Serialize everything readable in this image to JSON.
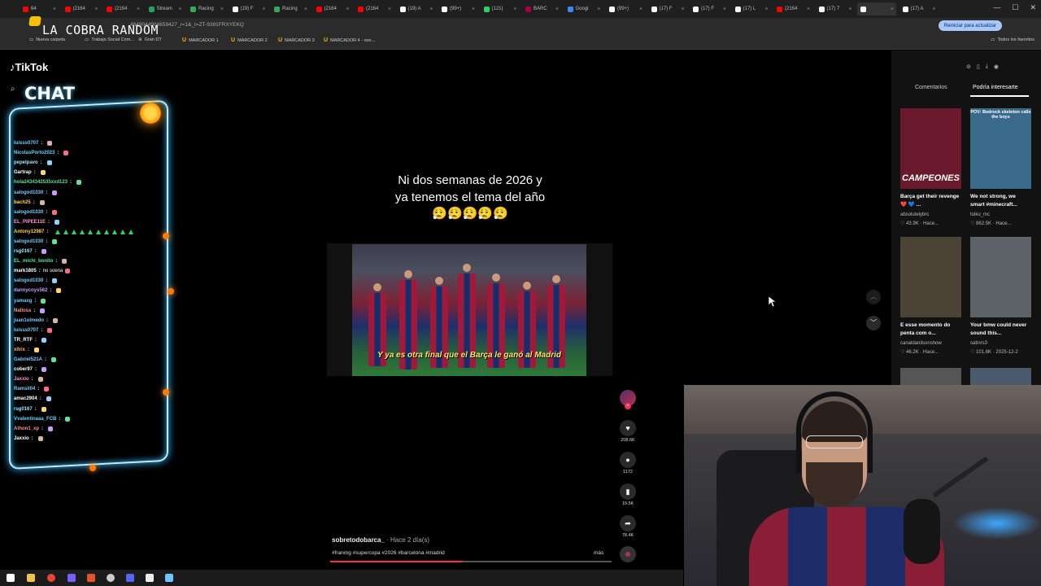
{
  "browser": {
    "tabs": [
      {
        "label": "64",
        "color": "#ff0000"
      },
      {
        "label": "(2164",
        "color": "#ff0000"
      },
      {
        "label": "(2164",
        "color": "#ff0000"
      },
      {
        "label": "Stream",
        "color": "#21a366"
      },
      {
        "label": "Racing",
        "color": "#34a853"
      },
      {
        "label": "(19) F",
        "color": "#ffffff"
      },
      {
        "label": "Racing",
        "color": "#34a853"
      },
      {
        "label": "(2164",
        "color": "#ff0000"
      },
      {
        "label": "(2164",
        "color": "#ff0000"
      },
      {
        "label": "(19) A",
        "color": "#ffffff"
      },
      {
        "label": "(99+)",
        "color": "#ffffff"
      },
      {
        "label": "(121)",
        "color": "#25d366"
      },
      {
        "label": "BARC",
        "color": "#a50044"
      },
      {
        "label": "Googl",
        "color": "#4285f4"
      },
      {
        "label": "(99+)",
        "color": "#ffffff"
      },
      {
        "label": "(17) F",
        "color": "#ffffff"
      },
      {
        "label": "(17) F",
        "color": "#ffffff"
      },
      {
        "label": "(17) L",
        "color": "#ffffff"
      },
      {
        "label": "(2164",
        "color": "#ff0000"
      },
      {
        "label": "(17) 7",
        "color": "#ffffff"
      },
      {
        "label": "",
        "color": "#ffffff",
        "active": true
      },
      {
        "label": "(17) A",
        "color": "#ffffff"
      }
    ],
    "url": "4849044904659427_r=1&_t=ZT-9391FRXYEKQ",
    "update_button": "Reiniciar para actualizar",
    "bookmarks": [
      {
        "label": "Nueva carpeta",
        "icon": "folder-icon"
      },
      {
        "label": "Trabajo Social Com...",
        "icon": "doc-icon"
      },
      {
        "label": "Gran DT",
        "icon": "globe-icon"
      },
      {
        "label": "MARCADOR 1",
        "icon": "u-icon"
      },
      {
        "label": "MARCADOR 2",
        "icon": "u-icon"
      },
      {
        "label": "MARCADOR 3",
        "icon": "u-icon"
      },
      {
        "label": "MARCADOR 4 - ove...",
        "icon": "u-icon"
      }
    ],
    "all_bookmarks": "Todos los favoritos"
  },
  "overlay": {
    "stream_title": "LA COBRA RANDOM",
    "chat_title": "CHAT"
  },
  "tiktok": {
    "logo": "TikTok",
    "chat_messages": [
      {
        "user": "luisss0707",
        "color": "#6ad1ff",
        "text": ""
      },
      {
        "user": "NicolasPorto2023",
        "color": "#6ad1ff",
        "text": ""
      },
      {
        "user": "pepelpavo",
        "color": "#9be8ff",
        "text": ""
      },
      {
        "user": "Gartrap",
        "color": "#ffffff",
        "text": ""
      },
      {
        "user": "hola2434342535xxd123",
        "color": "#5fe39a",
        "text": ""
      },
      {
        "user": "salogod1030",
        "color": "#7cc8ff",
        "text": ""
      },
      {
        "user": "bach25",
        "color": "#ffd86b",
        "text": ""
      },
      {
        "user": "salogod1030",
        "color": "#7cc8ff",
        "text": ""
      },
      {
        "user": "EL_PIPEE11E",
        "color": "#ff8fd0",
        "text": ""
      },
      {
        "user": "Antony12987",
        "color": "#ffcf4a",
        "text": "",
        "green": true
      },
      {
        "user": "salogod1030",
        "color": "#7cc8ff",
        "text": ""
      },
      {
        "user": "rsg0167",
        "color": "#9be8ff",
        "text": ""
      },
      {
        "user": "EL_michi_bonito",
        "color": "#5fe39a",
        "text": ""
      },
      {
        "user": "mark1805",
        "color": "#ffffff",
        "text": "no suena"
      },
      {
        "user": "salogod1030",
        "color": "#7cc8ff",
        "text": ""
      },
      {
        "user": "dannycoys562",
        "color": "#c99bff",
        "text": ""
      },
      {
        "user": "yamaxg",
        "color": "#6ad1ff",
        "text": ""
      },
      {
        "user": "Nalloss",
        "color": "#ff8f8f",
        "text": ""
      },
      {
        "user": "juan1olmedo",
        "color": "#7cc8ff",
        "text": ""
      },
      {
        "user": "luisss0707",
        "color": "#6ad1ff",
        "text": ""
      },
      {
        "user": "TR_RTF",
        "color": "#ffffff",
        "text": ""
      },
      {
        "user": "xllrix",
        "color": "#ffb36b",
        "text": ""
      },
      {
        "user": "Gabriel521A",
        "color": "#7cc8ff",
        "text": ""
      },
      {
        "user": "cober97",
        "color": "#ffffff",
        "text": ""
      },
      {
        "user": "Jaxxio",
        "color": "#ff8fd0",
        "text": ""
      },
      {
        "user": "Ramsil04",
        "color": "#7cc8ff",
        "text": ""
      },
      {
        "user": "amac2904",
        "color": "#ffffff",
        "text": ""
      },
      {
        "user": "rsg0167",
        "color": "#9be8ff",
        "text": ""
      },
      {
        "user": "Vvalentinaaa_FCB",
        "color": "#6ad1ff",
        "text": ""
      },
      {
        "user": "Athon1_xp",
        "color": "#ff8f8f",
        "text": ""
      },
      {
        "user": "Jaxxio",
        "color": "#ffffff",
        "text": ""
      }
    ],
    "video": {
      "caption_lines": [
        "Ni dos semanas de 2026 y",
        "ya tenemos el tema del año",
        "😮‍💨😮‍💨😮‍💨😮‍💨😮‍💨"
      ],
      "subtitle": "Y ya es otra final que el Barça le ganó al Madrid",
      "author": "sobretodobarca_",
      "time": "· Hace 2 día(s)",
      "hashtags": "#franmg #supercopa #2026 #barcelona #madrid",
      "more": "más",
      "progress_fraction": 0.47
    },
    "actions": {
      "likes": "208.6K",
      "comments": "1172",
      "saves": "19.5K",
      "shares": "78.4K"
    },
    "side_panel": {
      "tab_comments": "Comentarios",
      "tab_interest": "Podría interesarte",
      "videos": [
        {
          "title": "Barça get their revenge ❤️ 💙 ...",
          "author": "absolutelybrc",
          "stats": "♡ 43.9K · Hace...",
          "overlay": "CAMPEONES",
          "bg": "#6a1a2c"
        },
        {
          "title": "We not strong, we smart #minecraft...",
          "author": "toiku_mc",
          "stats": "♡ 862.5K · Hace...",
          "overlay": "POV: Bedrock skeleton calls the boys",
          "bg": "#3a6a8a"
        },
        {
          "title": "E esse momento do penta com o...",
          "author": "canaldanilsonshow",
          "stats": "♡ 46.2K · Hace...",
          "overlay": "",
          "bg": "#4a4336"
        },
        {
          "title": "Your bmw could never sound this...",
          "author": "satinrs3",
          "stats": "♡ 101.6K · 2025-12-2",
          "overlay": "",
          "bg": "#5c6268"
        }
      ]
    }
  }
}
